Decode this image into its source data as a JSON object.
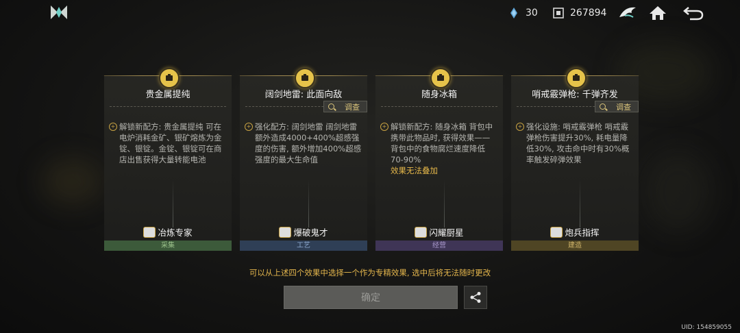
{
  "resources": [
    {
      "name": "energy",
      "icon": "crystal-icon",
      "value": "30"
    },
    {
      "name": "currency",
      "icon": "chip-icon",
      "value": "267894"
    }
  ],
  "cards": [
    {
      "title": "贵金属提纯",
      "has_inspect": false,
      "desc": "解锁新配方: 贵金属提纯<br>可在电炉消耗金矿、银矿熔炼为金锭、银锭。金锭、银锭可在商店出售获得大量转能电池",
      "desc_text": "解锁新配方: 贵金属提纯 可在电炉消耗金矿、银矿熔炼为金锭、银锭。金锭、银锭可在商店出售获得大量转能电池",
      "highlight": "",
      "badge": "冶炼专家",
      "category": "采集",
      "cat_color": "#3c5a3a",
      "cat_text_color": "#9ac08a"
    },
    {
      "title": "阔剑地雷: 此面向敌",
      "has_inspect": true,
      "desc_text": "强化配方: 阔剑地雷 阔剑地雷额外造成4000+400%超感强度的伤害, 额外增加400%超感强度的最大生命值",
      "highlight": "",
      "badge": "爆破鬼才",
      "category": "工艺",
      "cat_color": "#2f3f56",
      "cat_text_color": "#8eaad0"
    },
    {
      "title": "随身冰箱",
      "has_inspect": false,
      "desc_text": "解锁新配方: 随身冰箱 背包中携带此物品时, 获得效果——背包中的食物腐烂速度降低70-90%",
      "highlight": "效果无法叠加",
      "badge": "闪耀厨星",
      "category": "经营",
      "cat_color": "#3f3556",
      "cat_text_color": "#a898cc"
    },
    {
      "title": "哨戒霰弹枪: 千弹齐发",
      "has_inspect": true,
      "desc_text": "强化设施: 哨戒霰弹枪 哨戒霰弹枪伤害提升30%, 耗电量降低30%, 攻击命中时有30%概率触发碎弹效果",
      "highlight": "",
      "badge": "炮兵指挥",
      "category": "建造",
      "cat_color": "#4f4524",
      "cat_text_color": "#d0b56a"
    }
  ],
  "inspect_label": "调查",
  "hint": "可以从上述四个效果中选择一个作为专精效果, 选中后将无法随时更改",
  "confirm_label": "确定",
  "uid": "UID: 154859055",
  "colors": {
    "accent": "#e3b54c",
    "button_disabled": "#5b5b58"
  }
}
